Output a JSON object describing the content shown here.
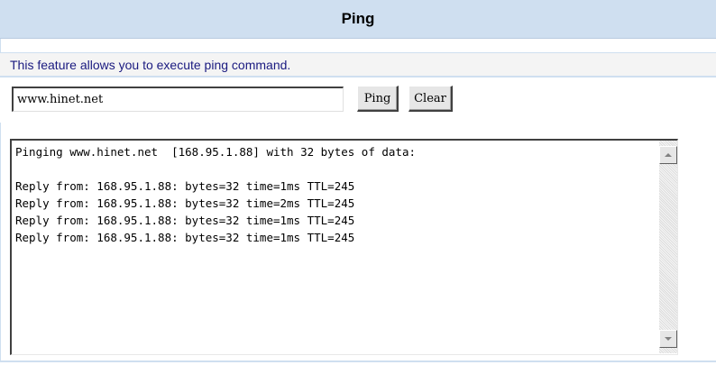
{
  "header": {
    "title": "Ping"
  },
  "description": "This feature allows you to execute ping command.",
  "form": {
    "host_value": "www.hinet.net",
    "ping_label": "Ping",
    "clear_label": "Clear"
  },
  "output": {
    "lines": [
      "Pinging www.hinet.net  [168.95.1.88] with 32 bytes of data:",
      "",
      "Reply from: 168.95.1.88: bytes=32 time=1ms TTL=245",
      "Reply from: 168.95.1.88: bytes=32 time=2ms TTL=245",
      "Reply from: 168.95.1.88: bytes=32 time=1ms TTL=245",
      "Reply from: 168.95.1.88: bytes=32 time=1ms TTL=245"
    ]
  },
  "icons": {
    "scroll_up": "scroll-up-arrow-icon",
    "scroll_down": "scroll-down-arrow-icon"
  },
  "colors": {
    "header_bg": "#cfdff0",
    "description_text": "#1a1a80",
    "description_bg": "#f4f4f4"
  }
}
